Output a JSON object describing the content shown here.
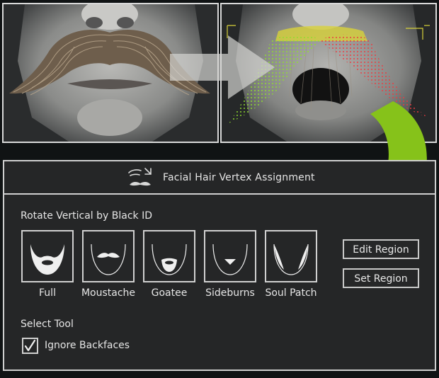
{
  "panel": {
    "title": "Facial Hair Vertex Assignment",
    "section_label": "Rotate Vertical by Black ID",
    "styles": [
      {
        "label": "Full",
        "icon": "full-beard-icon"
      },
      {
        "label": "Moustache",
        "icon": "moustache-icon"
      },
      {
        "label": "Goatee",
        "icon": "goatee-icon"
      },
      {
        "label": "Sideburns",
        "icon": "sideburns-icon"
      },
      {
        "label": "Soul Patch",
        "icon": "soul-patch-icon"
      }
    ],
    "edit_region_label": "Edit Region",
    "set_region_label": "Set Region",
    "select_tool_label": "Select Tool",
    "ignore_backfaces_label": "Ignore Backfaces",
    "ignore_backfaces_checked": true
  },
  "viewports": {
    "left": "moustache-render",
    "right": "vertex-assignment-render"
  },
  "colors": {
    "panel_bg": "#252627",
    "border": "#cfcfcf",
    "accent_green": "#86c21a",
    "vertex_green": "#7fd12b",
    "vertex_red": "#e0343c",
    "highlight_yellow": "#d8d23a"
  }
}
